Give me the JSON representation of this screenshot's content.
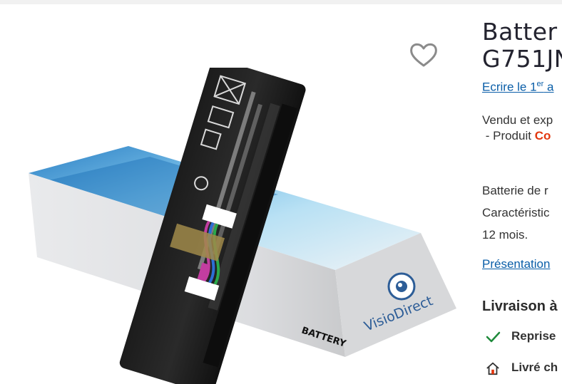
{
  "product": {
    "title_line1": "Batter",
    "title_line2": "G751JN",
    "review_prefix": "Ecrire le 1",
    "review_sup": "er",
    "review_suffix": " a",
    "seller_line1": "Vendu et exp",
    "seller_line2_prefix": " - Produit ",
    "seller_brand": "Co",
    "desc_lines": [
      "Batterie de r",
      "Caractéristic",
      "12 mois."
    ],
    "presentation_link": "Présentation",
    "delivery_title": "Livraison à",
    "features": [
      {
        "icon": "check-icon",
        "label": "Reprise"
      },
      {
        "icon": "home-icon",
        "label": "Livré ch"
      }
    ]
  },
  "image": {
    "battery_label": "BATTERY",
    "box_brand": "VisioDirect"
  },
  "colors": {
    "link": "#0a5ea8",
    "brand_accent": "#e2370f",
    "check": "#1f8a3b"
  }
}
